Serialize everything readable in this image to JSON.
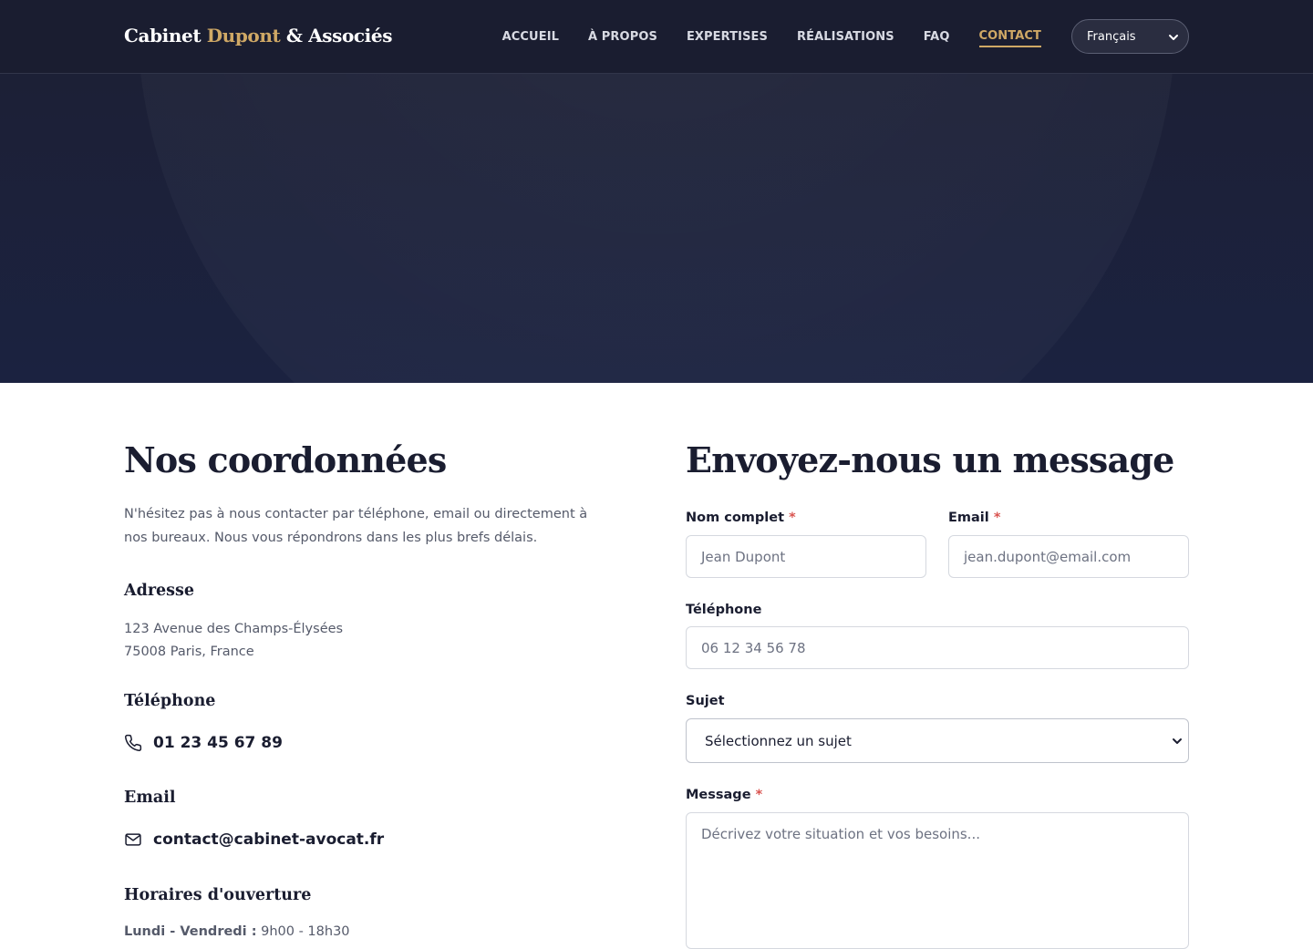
{
  "nav": {
    "brand_part1": "Cabinet ",
    "brand_accent": "Dupont",
    "brand_part2": " & Associés",
    "items": [
      {
        "label": "ACCUEIL",
        "active": false
      },
      {
        "label": "À PROPOS",
        "active": false
      },
      {
        "label": "EXPERTISES",
        "active": false
      },
      {
        "label": "RÉALISATIONS",
        "active": false
      },
      {
        "label": "FAQ",
        "active": false
      },
      {
        "label": "CONTACT",
        "active": true
      }
    ],
    "language": "Français"
  },
  "colors": {
    "navy": "#1a1d30",
    "gold": "#cfa865",
    "required": "#d9534f"
  },
  "contact_info": {
    "title": "Nos coordonnées",
    "intro": "N'hésitez pas à nous contacter par téléphone, email ou directement à nos bureaux. Nous vous répondrons dans les plus brefs délais.",
    "address_title": "Adresse",
    "address_line1": "123 Avenue des Champs-Élysées",
    "address_line2": "75008 Paris, France",
    "phone_title": "Téléphone",
    "phone_icon": "phone-icon",
    "phone": "01 23 45 67 89",
    "email_title": "Email",
    "email_icon": "mail-icon",
    "email": "contact@cabinet-avocat.fr",
    "hours_title": "Horaires d'ouverture",
    "hours_days": "Lundi - Vendredi :",
    "hours_time": " 9h00 - 18h30"
  },
  "form": {
    "title": "Envoyez-nous un message",
    "required_mark": "*",
    "name_label": "Nom complet",
    "name_placeholder": "Jean Dupont",
    "email_label": "Email",
    "email_placeholder": "jean.dupont@email.com",
    "phone_label": "Téléphone",
    "phone_placeholder": "06 12 34 56 78",
    "subject_label": "Sujet",
    "subject_selected": "Sélectionnez un sujet",
    "message_label": "Message",
    "message_placeholder": "Décrivez votre situation et vos besoins..."
  }
}
